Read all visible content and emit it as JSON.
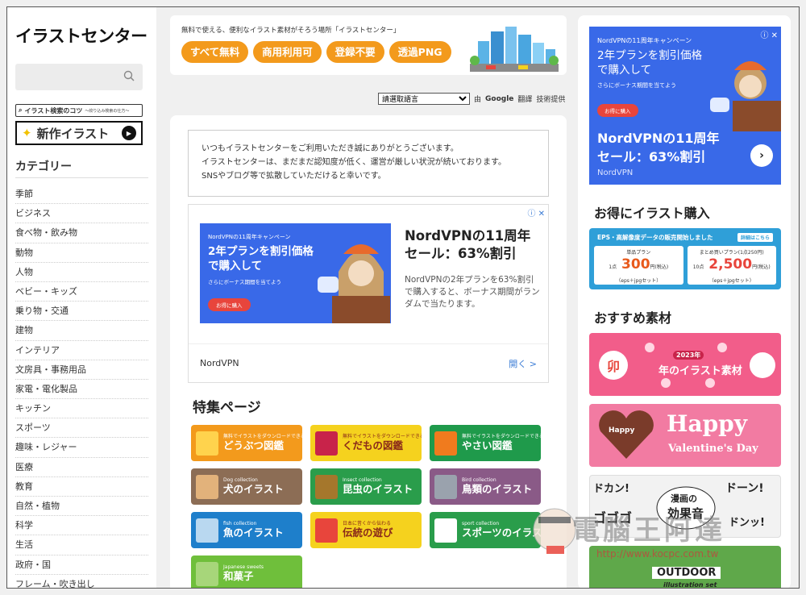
{
  "sidebar": {
    "logo": "イラストセンター",
    "search_placeholder": "",
    "tips_label": "イラスト検索のコツ",
    "tips_sub": "〜絞り込み検索の仕方〜",
    "new_label": "新作イラスト",
    "categories_title": "カテゴリー",
    "categories": [
      "季節",
      "ビジネス",
      "食べ物・飲み物",
      "動物",
      "人物",
      "ベビー・キッズ",
      "乗り物・交通",
      "建物",
      "インテリア",
      "文房具・事務用品",
      "家電・電化製品",
      "キッチン",
      "スポーツ",
      "趣味・レジャー",
      "医療",
      "教育",
      "自然・植物",
      "科学",
      "生活",
      "政府・国",
      "フレーム・吹き出し"
    ]
  },
  "banner": {
    "tagline": "無料で使える、便利なイラスト素材がそろう場所「イラストセンター」",
    "pills": [
      "すべて無料",
      "商用利用可",
      "登録不要",
      "透過PNG"
    ]
  },
  "translate": {
    "select_value": "請選取語言",
    "prefix": "由",
    "google": "Google",
    "service": "翻譯",
    "suffix": "技術提供"
  },
  "notice": {
    "line1": "いつもイラストセンターをご利用いただき誠にありがとうございます。",
    "line2": "イラストセンターは、まだまだ認知度が低く、運営が厳しい状況が続いております。",
    "line3": "SNSやブログ等で拡散していただけると幸いです。"
  },
  "ad_mid": {
    "small": "NordVPNの11周年キャンペーン",
    "big1": "2年プランを割引価格",
    "big2": "で購入して",
    "sub": "さらにボーナス期間を当てよう",
    "btn": "お得に購入",
    "headline1": "NordVPNの11周年",
    "headline2": "セール：63%割引",
    "body": "NordVPNの2年プランを63%割引で購入すると、ボーナス期間がランダムで当たります。",
    "brand": "NordVPN",
    "open": "開く"
  },
  "feature": {
    "title": "特集ページ",
    "tiles": [
      {
        "title": "どうぶつ図鑑",
        "sub": "無料でイラストをダウンロードできる",
        "color": "#f39a1c",
        "icon": "#ffd34d"
      },
      {
        "title": "くだもの図鑑",
        "sub": "無料でイラストをダウンロードできる",
        "color": "#f5d21e",
        "icon": "#c8234a"
      },
      {
        "title": "やさい図鑑",
        "sub": "無料でイラストをダウンロードできる",
        "color": "#1f9a4b",
        "icon": "#f07b1e"
      },
      {
        "title": "犬のイラスト",
        "sub": "Dog collection",
        "color": "#8c6d55",
        "icon": "#e2b27b"
      },
      {
        "title": "昆虫のイラスト",
        "sub": "Insect collection",
        "color": "#2a9d4b",
        "icon": "#a5772c"
      },
      {
        "title": "鳥類のイラスト",
        "sub": "Bird collection",
        "color": "#8a5a87",
        "icon": "#9aa2ad"
      },
      {
        "title": "魚のイラスト",
        "sub": "fish collection",
        "color": "#1e7fcb",
        "icon": "#b9d8f0"
      },
      {
        "title": "伝統の遊び",
        "sub": "日本に昔くから伝わる",
        "color": "#f5d21e",
        "icon": "#e8453c"
      },
      {
        "title": "スポーツのイラスト",
        "sub": "sport collection",
        "color": "#2a9d4b",
        "icon": "#ffffff"
      },
      {
        "title": "和菓子",
        "sub": "Japanese sweets",
        "color": "#6fbf3b",
        "icon": "#a7d67a"
      }
    ]
  },
  "ad_right": {
    "small": "NordVPNの11周年キャンペーン",
    "big1": "2年プランを割引価格",
    "big2": "で購入して",
    "sub": "さらにボーナス期間を当てよう",
    "btn": "お得に購入",
    "head1": "NordVPNの11周年",
    "head2": "セール：63%割引",
    "brand": "NordVPN"
  },
  "buy": {
    "title": "お得にイラスト購入",
    "head": "EPS・高解像度データの販売開始しました",
    "tag": "詳細はこちら",
    "plan1": "単品プラン",
    "plan1_qty": "1点",
    "plan1_price": "300",
    "plan1_unit": "円(税込)",
    "plan1_note": "（eps＋jpgセット）",
    "plan2": "まとめ買いプラン(1点250円)",
    "plan2_qty": "10点",
    "plan2_price": "2,500",
    "plan2_unit": "円(税込)",
    "plan2_note": "（eps＋jpgセット）"
  },
  "recommend": {
    "title": "おすすめ素材",
    "r1_year": "2023年",
    "r1_text": "年のイラスト素材",
    "r1_badge": "卯",
    "r2_title": "Happy",
    "r2_sub": "Valentine's Day",
    "r3_title1": "漫画の",
    "r3_title2": "効果音",
    "r4_title": "OUTDOOR",
    "r4_sub": "illustration set"
  },
  "watermark": {
    "text": "電腦王阿達",
    "url": "http://www.kocpc.com.tw"
  },
  "colors": {
    "accent": "#f39a1c",
    "nord_blue": "#3969e8",
    "buy_blue": "#2f9fd8"
  }
}
